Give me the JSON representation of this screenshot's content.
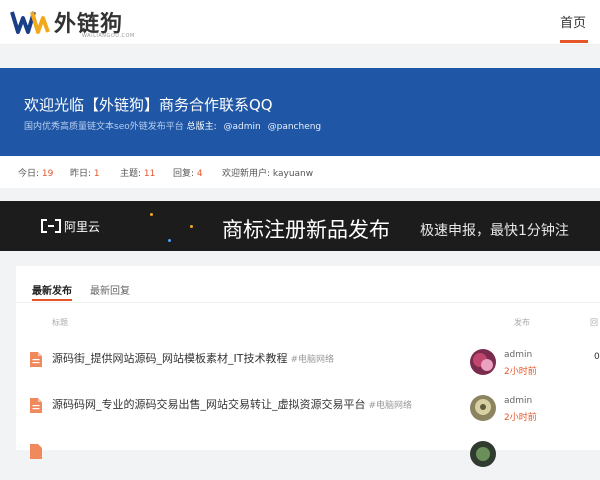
{
  "header": {
    "logo_name": "外链狗",
    "logo_sub": "WAILIANGOU.COM",
    "nav_home": "首页"
  },
  "banner": {
    "title": "欢迎光临【外链狗】商务合作联系QQ",
    "subtitle": "国内优秀高质量链文本seo外链发布平台",
    "moderators_label": "总版主:",
    "moderators": [
      "@admin",
      "@pancheng"
    ]
  },
  "stats": {
    "today_label": "今日:",
    "today": "19",
    "yesterday_label": "昨日:",
    "yesterday": "1",
    "topics_label": "主题:",
    "topics": "11",
    "replies_label": "回复:",
    "replies": "4",
    "newest_label": "欢迎新用户:",
    "newest_user": "kayuanw"
  },
  "ad": {
    "brand": "阿里云",
    "headline": "商标注册新品发布",
    "tagline": "极速申报，最快1分钟注"
  },
  "tabs": [
    {
      "label": "最新发布",
      "active": true
    },
    {
      "label": "最新回复",
      "active": false
    }
  ],
  "columns": {
    "title": "标题",
    "publish": "发布",
    "reply": "回"
  },
  "posts": [
    {
      "title": "源码街_提供网站源码_网站模板素材_IT技术教程",
      "tag": "#电脑网络",
      "author": "admin",
      "time": "2小时前",
      "count": "0"
    },
    {
      "title": "源码码网_专业的源码交易出售_网站交易转让_虚拟资源交易平台",
      "tag": "#电脑网络",
      "author": "admin",
      "time": "2小时前",
      "count": ""
    },
    {
      "title": "",
      "tag": "",
      "author": "",
      "time": "",
      "count": ""
    }
  ],
  "colors": {
    "accent": "#e6562b",
    "banner": "#1f57a6",
    "ad_bg": "#1c1c1c"
  }
}
